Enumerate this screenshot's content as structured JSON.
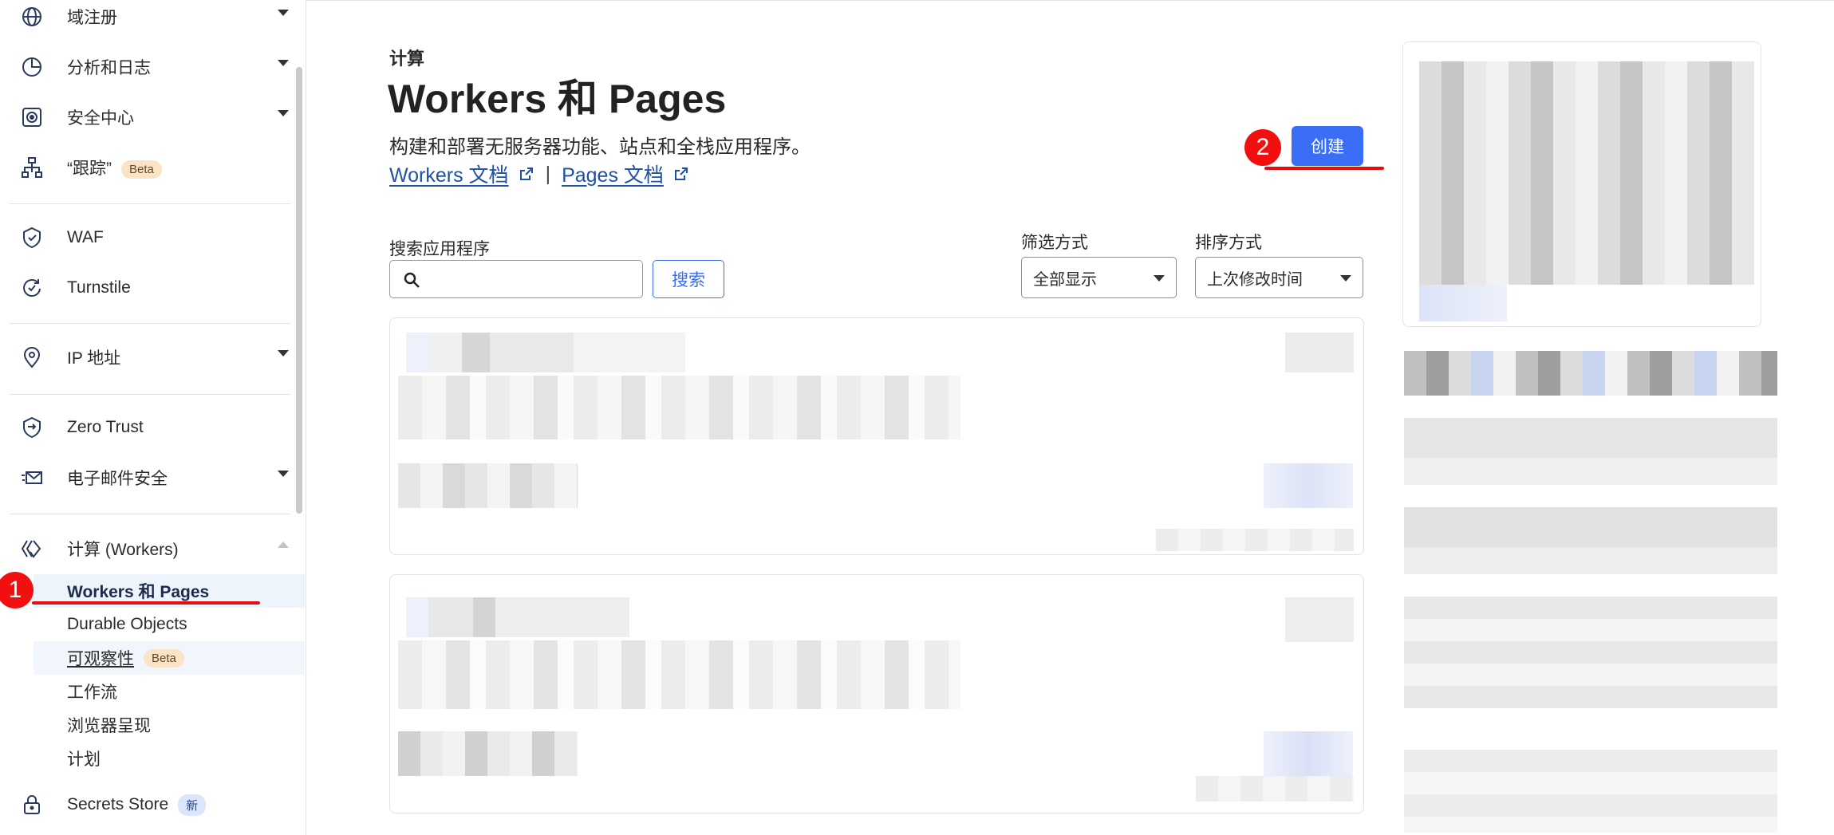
{
  "sidebar": {
    "items": [
      {
        "label": "域注册",
        "icon": "globe-icon"
      },
      {
        "label": "分析和日志",
        "icon": "pie-chart-icon"
      },
      {
        "label": "安全中心",
        "icon": "shield-target-icon"
      },
      {
        "label": "“跟踪”",
        "icon": "trace-network-icon",
        "badge": "Beta"
      },
      {
        "label": "WAF",
        "icon": "waf-shield-icon"
      },
      {
        "label": "Turnstile",
        "icon": "turnstile-icon"
      },
      {
        "label": "IP 地址",
        "icon": "location-pin-icon"
      },
      {
        "label": "Zero Trust",
        "icon": "zero-trust-icon"
      },
      {
        "label": "电子邮件安全",
        "icon": "email-security-icon"
      },
      {
        "label": "计算 (Workers)",
        "icon": "workers-icon"
      },
      {
        "label": "Secrets Store",
        "icon": "lock-icon",
        "badge": "新"
      }
    ],
    "compute_sub": [
      {
        "label": "Workers 和 Pages"
      },
      {
        "label": "Durable Objects"
      },
      {
        "label": "可观察性",
        "badge": "Beta"
      },
      {
        "label": "工作流"
      },
      {
        "label": "浏览器呈现"
      },
      {
        "label": "计划"
      }
    ]
  },
  "annotations": {
    "one": "1",
    "two": "2"
  },
  "main": {
    "section_label": "计算",
    "title": "Workers 和 Pages",
    "description": "构建和部署无服务器功能、站点和全栈应用程序。",
    "workers_docs": "Workers 文档",
    "separator": "|",
    "pages_docs": "Pages 文档",
    "create_button": "创建",
    "search_label": "搜索应用程序",
    "search_value": "",
    "search_button": "搜索",
    "filter_label": "筛选方式",
    "filter_value": "全部显示",
    "sort_label": "排序方式",
    "sort_value": "上次修改时间"
  },
  "colors": {
    "accent": "#3b6ef6",
    "annotation": "#f20f0f",
    "link": "#1e50a8"
  }
}
